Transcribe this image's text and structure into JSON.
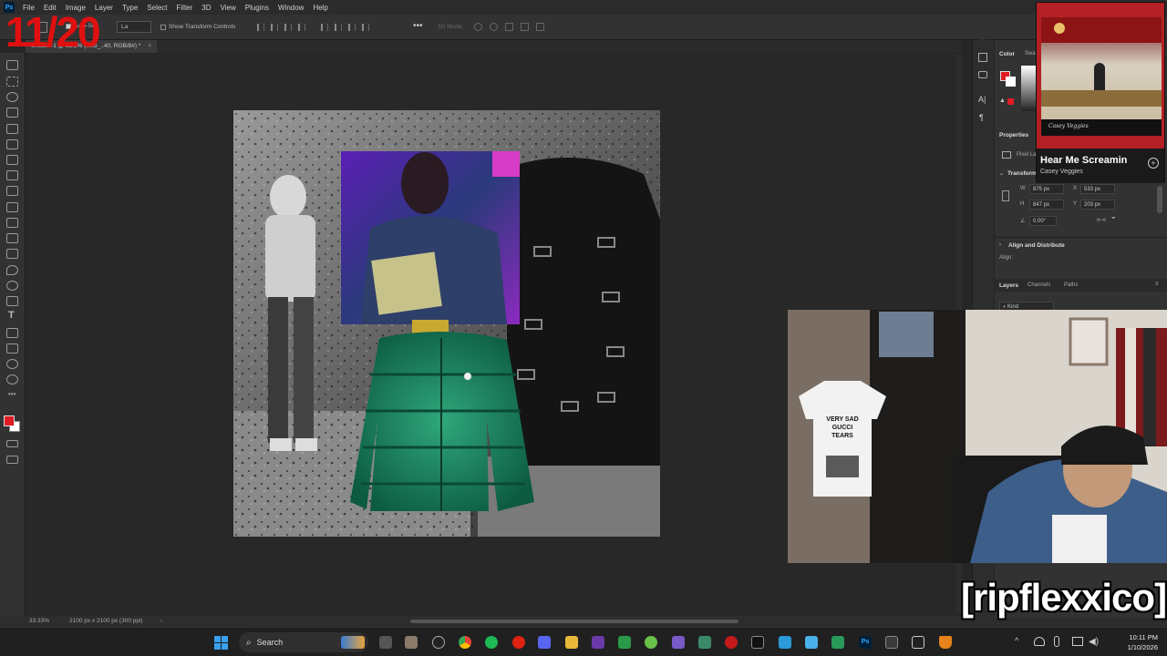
{
  "app": {
    "menu": [
      "File",
      "Edit",
      "Image",
      "Layer",
      "Type",
      "Select",
      "Filter",
      "3D",
      "View",
      "Plugins",
      "Window",
      "Help"
    ]
  },
  "options_bar": {
    "auto_select": "Auto-Sel",
    "layer_dd": "La",
    "show_transform_controls": "Show Transform Controls",
    "mode_3d": "3D Mode:"
  },
  "document": {
    "tab_title": "Untitled-1 @ 33.3% (IMG_..40, RGB/8#) *",
    "zoom": "33.33%",
    "size_info": "2100 px x 2100 px (300 ppi)"
  },
  "panels": {
    "color_tab": "Color",
    "swatches_tab": "Swa",
    "properties_title": "Properties",
    "pixel_layer": "Pixel La",
    "transform_title": "Transform",
    "w_label": "W",
    "w_value": "875 px",
    "h_label": "H",
    "h_value": "847 px",
    "x_label": "X",
    "x_value": "533 px",
    "y_label": "Y",
    "y_value": "203 px",
    "angle_value": "0.00°",
    "align_title": "Align and Distribute",
    "align_label": "Align:",
    "layers_tab": "Layers",
    "channels_tab": "Channels",
    "paths_tab": "Paths",
    "kind_label": "Kind"
  },
  "music": {
    "title": "Hear Me Screamin",
    "artist": "Casey Veggies",
    "poster_caption": "Casey Veggies"
  },
  "overlay": {
    "tally": "11/20",
    "stream_name": "[ripflexxico]",
    "shirt_text": "VERY SAD GUCCI TEARS"
  },
  "taskbar": {
    "search_label": "Search",
    "time": "10:11 PM",
    "date": "1/10/2026"
  },
  "colors": {
    "foreground": "#e01b24",
    "background": "#ffffff",
    "brand_red": "#e01010"
  }
}
